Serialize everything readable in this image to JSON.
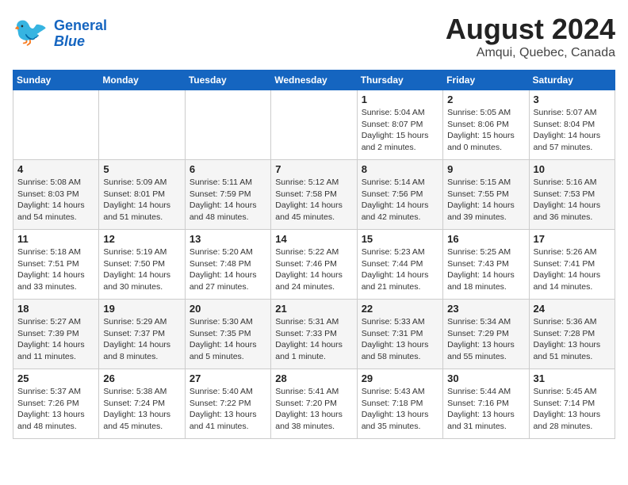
{
  "header": {
    "logo_line1": "General",
    "logo_line2": "Blue",
    "month": "August 2024",
    "location": "Amqui, Quebec, Canada"
  },
  "days_of_week": [
    "Sunday",
    "Monday",
    "Tuesday",
    "Wednesday",
    "Thursday",
    "Friday",
    "Saturday"
  ],
  "weeks": [
    [
      {
        "day": "",
        "info": ""
      },
      {
        "day": "",
        "info": ""
      },
      {
        "day": "",
        "info": ""
      },
      {
        "day": "",
        "info": ""
      },
      {
        "day": "1",
        "info": "Sunrise: 5:04 AM\nSunset: 8:07 PM\nDaylight: 15 hours\nand 2 minutes."
      },
      {
        "day": "2",
        "info": "Sunrise: 5:05 AM\nSunset: 8:06 PM\nDaylight: 15 hours\nand 0 minutes."
      },
      {
        "day": "3",
        "info": "Sunrise: 5:07 AM\nSunset: 8:04 PM\nDaylight: 14 hours\nand 57 minutes."
      }
    ],
    [
      {
        "day": "4",
        "info": "Sunrise: 5:08 AM\nSunset: 8:03 PM\nDaylight: 14 hours\nand 54 minutes."
      },
      {
        "day": "5",
        "info": "Sunrise: 5:09 AM\nSunset: 8:01 PM\nDaylight: 14 hours\nand 51 minutes."
      },
      {
        "day": "6",
        "info": "Sunrise: 5:11 AM\nSunset: 7:59 PM\nDaylight: 14 hours\nand 48 minutes."
      },
      {
        "day": "7",
        "info": "Sunrise: 5:12 AM\nSunset: 7:58 PM\nDaylight: 14 hours\nand 45 minutes."
      },
      {
        "day": "8",
        "info": "Sunrise: 5:14 AM\nSunset: 7:56 PM\nDaylight: 14 hours\nand 42 minutes."
      },
      {
        "day": "9",
        "info": "Sunrise: 5:15 AM\nSunset: 7:55 PM\nDaylight: 14 hours\nand 39 minutes."
      },
      {
        "day": "10",
        "info": "Sunrise: 5:16 AM\nSunset: 7:53 PM\nDaylight: 14 hours\nand 36 minutes."
      }
    ],
    [
      {
        "day": "11",
        "info": "Sunrise: 5:18 AM\nSunset: 7:51 PM\nDaylight: 14 hours\nand 33 minutes."
      },
      {
        "day": "12",
        "info": "Sunrise: 5:19 AM\nSunset: 7:50 PM\nDaylight: 14 hours\nand 30 minutes."
      },
      {
        "day": "13",
        "info": "Sunrise: 5:20 AM\nSunset: 7:48 PM\nDaylight: 14 hours\nand 27 minutes."
      },
      {
        "day": "14",
        "info": "Sunrise: 5:22 AM\nSunset: 7:46 PM\nDaylight: 14 hours\nand 24 minutes."
      },
      {
        "day": "15",
        "info": "Sunrise: 5:23 AM\nSunset: 7:44 PM\nDaylight: 14 hours\nand 21 minutes."
      },
      {
        "day": "16",
        "info": "Sunrise: 5:25 AM\nSunset: 7:43 PM\nDaylight: 14 hours\nand 18 minutes."
      },
      {
        "day": "17",
        "info": "Sunrise: 5:26 AM\nSunset: 7:41 PM\nDaylight: 14 hours\nand 14 minutes."
      }
    ],
    [
      {
        "day": "18",
        "info": "Sunrise: 5:27 AM\nSunset: 7:39 PM\nDaylight: 14 hours\nand 11 minutes."
      },
      {
        "day": "19",
        "info": "Sunrise: 5:29 AM\nSunset: 7:37 PM\nDaylight: 14 hours\nand 8 minutes."
      },
      {
        "day": "20",
        "info": "Sunrise: 5:30 AM\nSunset: 7:35 PM\nDaylight: 14 hours\nand 5 minutes."
      },
      {
        "day": "21",
        "info": "Sunrise: 5:31 AM\nSunset: 7:33 PM\nDaylight: 14 hours\nand 1 minute."
      },
      {
        "day": "22",
        "info": "Sunrise: 5:33 AM\nSunset: 7:31 PM\nDaylight: 13 hours\nand 58 minutes."
      },
      {
        "day": "23",
        "info": "Sunrise: 5:34 AM\nSunset: 7:29 PM\nDaylight: 13 hours\nand 55 minutes."
      },
      {
        "day": "24",
        "info": "Sunrise: 5:36 AM\nSunset: 7:28 PM\nDaylight: 13 hours\nand 51 minutes."
      }
    ],
    [
      {
        "day": "25",
        "info": "Sunrise: 5:37 AM\nSunset: 7:26 PM\nDaylight: 13 hours\nand 48 minutes."
      },
      {
        "day": "26",
        "info": "Sunrise: 5:38 AM\nSunset: 7:24 PM\nDaylight: 13 hours\nand 45 minutes."
      },
      {
        "day": "27",
        "info": "Sunrise: 5:40 AM\nSunset: 7:22 PM\nDaylight: 13 hours\nand 41 minutes."
      },
      {
        "day": "28",
        "info": "Sunrise: 5:41 AM\nSunset: 7:20 PM\nDaylight: 13 hours\nand 38 minutes."
      },
      {
        "day": "29",
        "info": "Sunrise: 5:43 AM\nSunset: 7:18 PM\nDaylight: 13 hours\nand 35 minutes."
      },
      {
        "day": "30",
        "info": "Sunrise: 5:44 AM\nSunset: 7:16 PM\nDaylight: 13 hours\nand 31 minutes."
      },
      {
        "day": "31",
        "info": "Sunrise: 5:45 AM\nSunset: 7:14 PM\nDaylight: 13 hours\nand 28 minutes."
      }
    ]
  ]
}
